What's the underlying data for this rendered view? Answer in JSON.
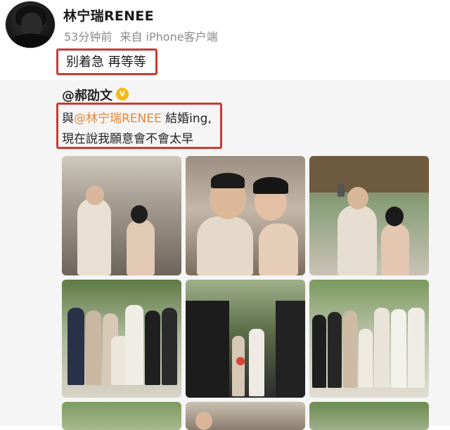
{
  "post": {
    "username": "林宁瑞RENEE",
    "time": "53分钟前",
    "source": "来自 iPhone客户端",
    "text": "别着急 再等等"
  },
  "repost": {
    "author": "@郝劭文",
    "badge": "v",
    "line1_prefix": "與",
    "line1_mention": "@林宁瑞RENEE",
    "line1_suffix": " 結婚ing,",
    "line2": "現在說我願意會不會太早"
  },
  "colors": {
    "highlight_box": "#c73c33",
    "mention": "#e8883a",
    "verified_badge": "#f5b915"
  },
  "photos": [
    {
      "name": "couple-photo-1"
    },
    {
      "name": "couple-photo-2"
    },
    {
      "name": "couple-selfie-photo"
    },
    {
      "name": "family-photo-1"
    },
    {
      "name": "garden-gate-photo"
    },
    {
      "name": "family-photo-2"
    },
    {
      "name": "photo-7"
    },
    {
      "name": "photo-8"
    },
    {
      "name": "photo-9"
    }
  ]
}
